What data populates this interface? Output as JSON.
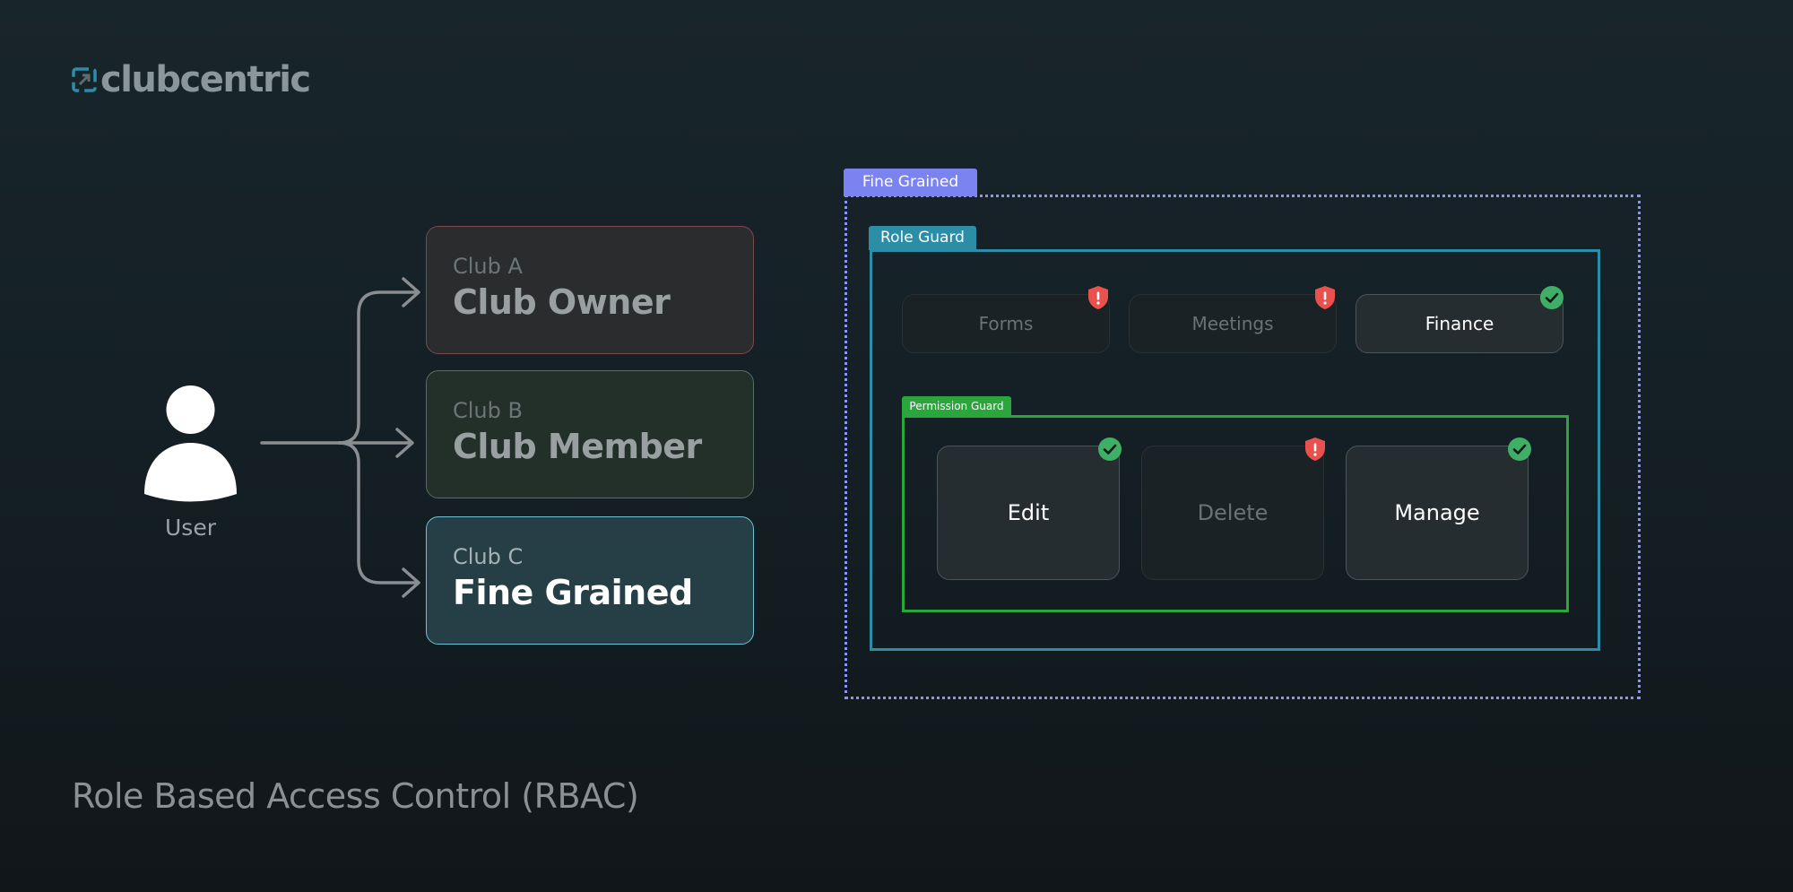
{
  "brand": {
    "logo_text": "clubcentric",
    "logo_icon": "clubcentric-logo-icon"
  },
  "user": {
    "label": "User",
    "icon": "user-icon"
  },
  "clubs": [
    {
      "name": "Club A",
      "role": "Club Owner"
    },
    {
      "name": "Club B",
      "role": "Club Member"
    },
    {
      "name": "Club C",
      "role": "Fine Grained"
    }
  ],
  "fine_grained": {
    "tag": "Fine Grained",
    "role_guard": {
      "tag": "Role Guard",
      "modules": [
        {
          "label": "Forms",
          "status": "denied"
        },
        {
          "label": "Meetings",
          "status": "denied"
        },
        {
          "label": "Finance",
          "status": "allowed"
        }
      ],
      "permission_guard": {
        "tag": "Permission Guard",
        "permissions": [
          {
            "label": "Edit",
            "status": "allowed"
          },
          {
            "label": "Delete",
            "status": "denied"
          },
          {
            "label": "Manage",
            "status": "allowed"
          }
        ]
      }
    }
  },
  "footer_title": "Role Based Access Control (RBAC)",
  "colors": {
    "fine_grained": "#7b83f0",
    "role_guard": "#2c8da6",
    "permission_guard": "#2ba63c",
    "allowed_badge": "#3fae66",
    "denied_badge": "#e8514d"
  }
}
